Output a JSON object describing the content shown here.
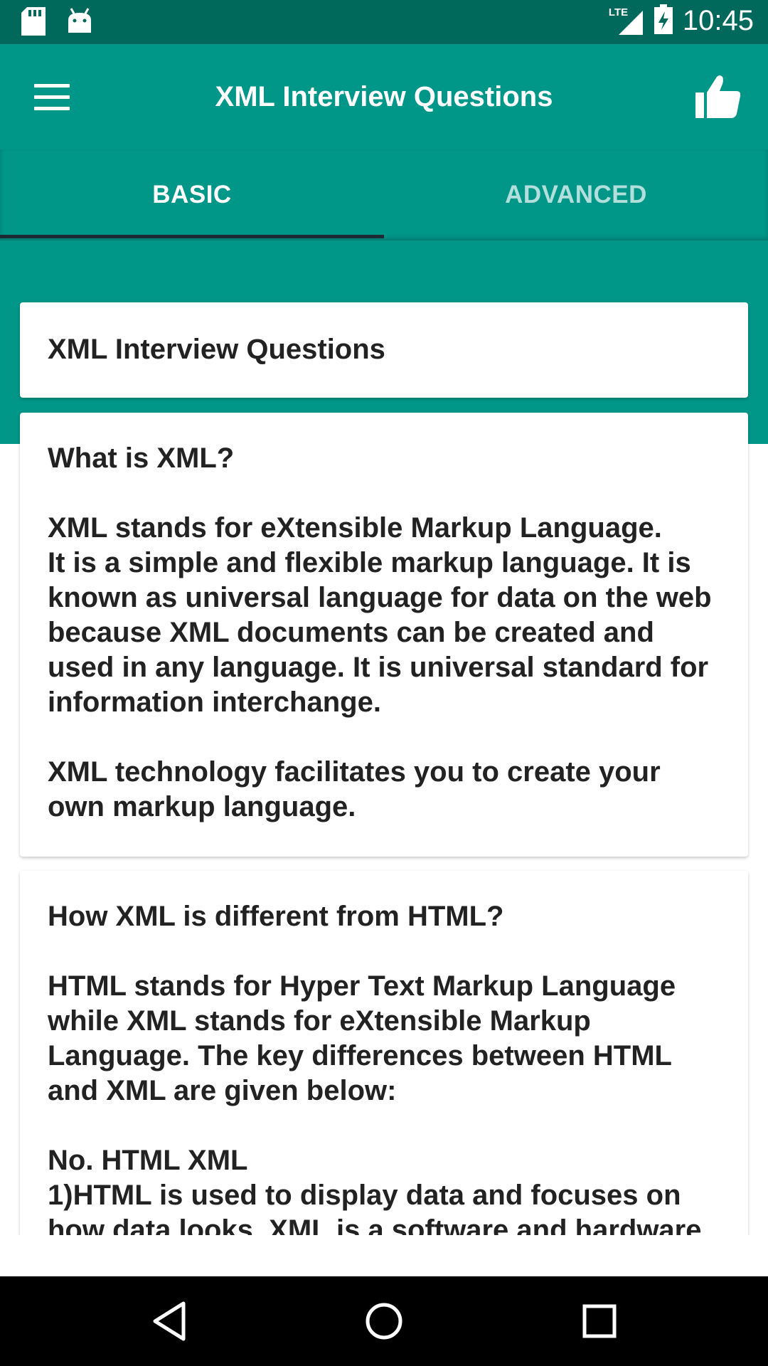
{
  "status_bar": {
    "network": "LTE",
    "time": "10:45",
    "icons": [
      "sd-card-icon",
      "android-icon",
      "lte-signal-icon",
      "battery-charging-icon"
    ]
  },
  "app_bar": {
    "title": "XML Interview Questions",
    "menu_icon": "hamburger-menu-icon",
    "action_icon": "thumbs-up-icon"
  },
  "tabs": [
    {
      "label": "BASIC",
      "selected": true
    },
    {
      "label": "ADVANCED",
      "selected": false
    }
  ],
  "colors": {
    "primary": "#009688",
    "primary_dark": "#00695c",
    "tab_indicator": "#1e2a33",
    "inactive_tab": "#b2dfdb"
  },
  "header_card": {
    "title": "XML Interview Questions"
  },
  "questions": [
    {
      "question": "What is XML?",
      "answer": "XML stands for eXtensible Markup Language.\nIt is a simple and flexible markup language. It is known as universal language for data on the web because XML documents can be created and used in any language. It is universal standard for information interchange.\n\nXML technology facilitates you to create your own markup language."
    },
    {
      "question": "How XML is different from HTML?",
      "answer": "HTML stands for Hyper Text Markup Language while XML stands for eXtensible Markup Language. The key differences between HTML and XML are given below:\n\nNo.  HTML XML\n1)HTML is used to display data and focuses on how data looks. XML is a software and hardware"
    }
  ],
  "nav_bar": {
    "buttons": [
      "back-icon",
      "home-icon",
      "recents-icon"
    ]
  }
}
